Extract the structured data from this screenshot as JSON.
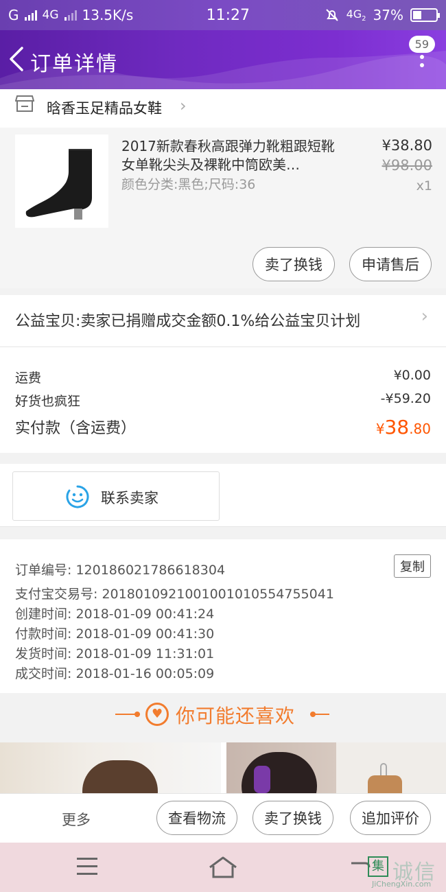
{
  "status_bar": {
    "carrier1": "G",
    "network": "4G",
    "speed": "13.5K/s",
    "time": "11:27",
    "network2": "4G",
    "network2_sub": "2",
    "battery": "37%",
    "battery_level": 0.37
  },
  "header": {
    "title": "订单详情",
    "badge": "59"
  },
  "shop": {
    "name": "晗香玉足精品女鞋"
  },
  "product": {
    "title": "2017新款春秋高跟弹力靴粗跟短靴女单靴尖头及裸靴中筒欧美…",
    "sku": "颜色分类:黑色;尺码:36",
    "price": "¥38.80",
    "original_price": "¥98.00",
    "quantity": "x1",
    "sell_button": "卖了换钱",
    "aftersale_button": "申请售后"
  },
  "charity": {
    "text": "公益宝贝:卖家已捐赠成交金额0.1%给公益宝贝计划"
  },
  "costs": {
    "shipping_label": "运费",
    "shipping_value": "¥0.00",
    "discount_label": "好货也疯狂",
    "discount_value": "-¥59.20",
    "total_label": "实付款（含运费）",
    "total_currency": "¥",
    "total_int": "38",
    "total_dec": ".80"
  },
  "contact": {
    "label": "联系卖家"
  },
  "order_info": {
    "order_no": "订单编号: 120186021786618304",
    "alipay_no": "支付宝交易号: 2018010921001001010554755041",
    "created": "创建时间: 2018-01-09 00:41:24",
    "paid": "付款时间: 2018-01-09 00:41:30",
    "shipped": "发货时间: 2018-01-09 11:31:01",
    "completed": "成交时间: 2018-01-16 00:05:09",
    "copy_button": "复制"
  },
  "recommend": {
    "title": "你可能还喜欢"
  },
  "actions": {
    "more": "更多",
    "logistics": "查看物流",
    "sell": "卖了换钱",
    "review": "追加评价"
  },
  "watermark": {
    "logo_char": "集",
    "brand": "诚信",
    "url": "JiChengXin.com"
  },
  "colors": {
    "accent": "#ff5500",
    "recommend": "#f27c2e",
    "header_purple": "#6f2ac0"
  }
}
